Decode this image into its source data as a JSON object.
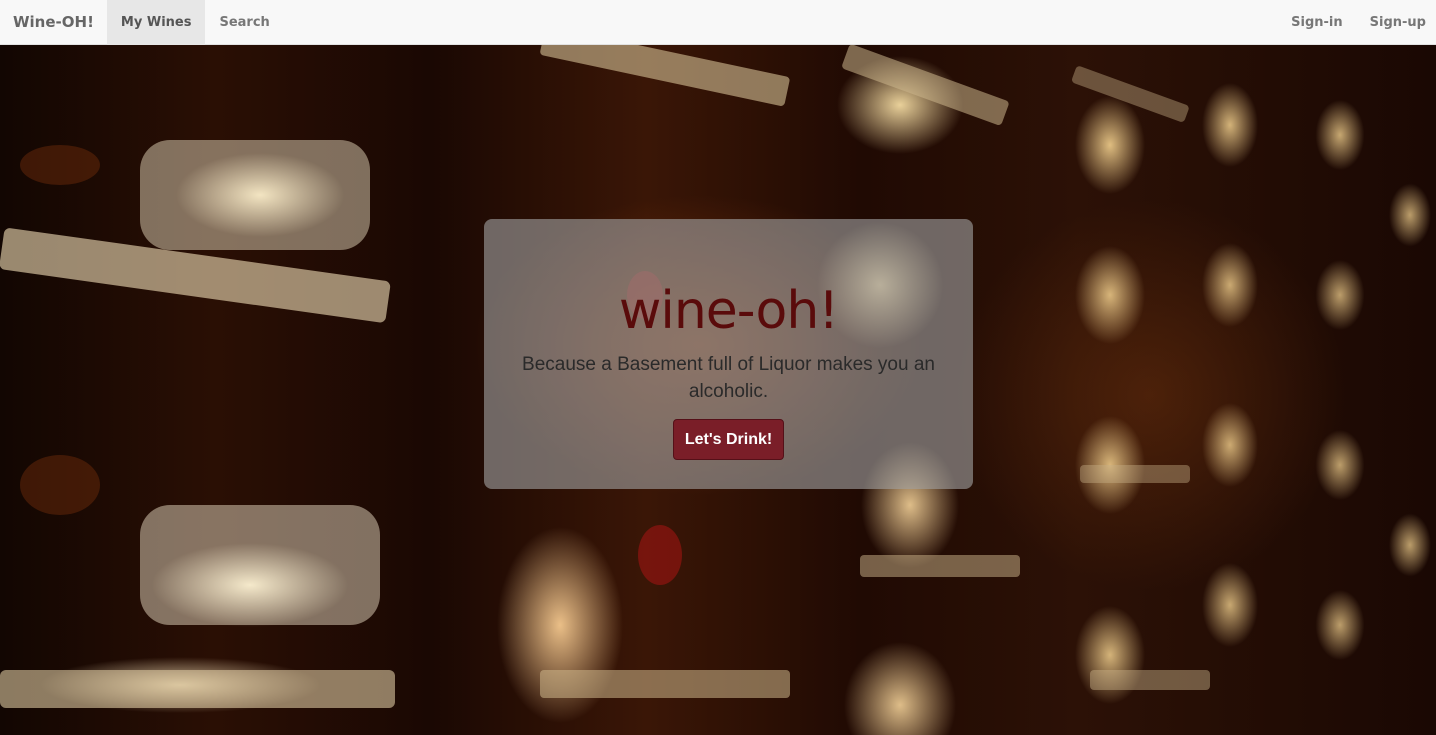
{
  "navbar": {
    "brand": "Wine-OH!",
    "left_links": [
      {
        "label": "My Wines",
        "active": true
      },
      {
        "label": "Search",
        "active": false
      }
    ],
    "right_links": [
      {
        "label": "Sign-in"
      },
      {
        "label": "Sign-up"
      }
    ]
  },
  "hero": {
    "background_image": "wine bottles in cellar rack",
    "title": "wine-oh!",
    "subtitle": "Because a Basement full of Liquor makes you an alcoholic.",
    "cta_label": "Let's Drink!"
  },
  "colors": {
    "title": "#5a0b0b",
    "button": "#7a1e28",
    "navbar_bg": "#f8f8f8",
    "active_tab_bg": "#e7e7e7"
  }
}
